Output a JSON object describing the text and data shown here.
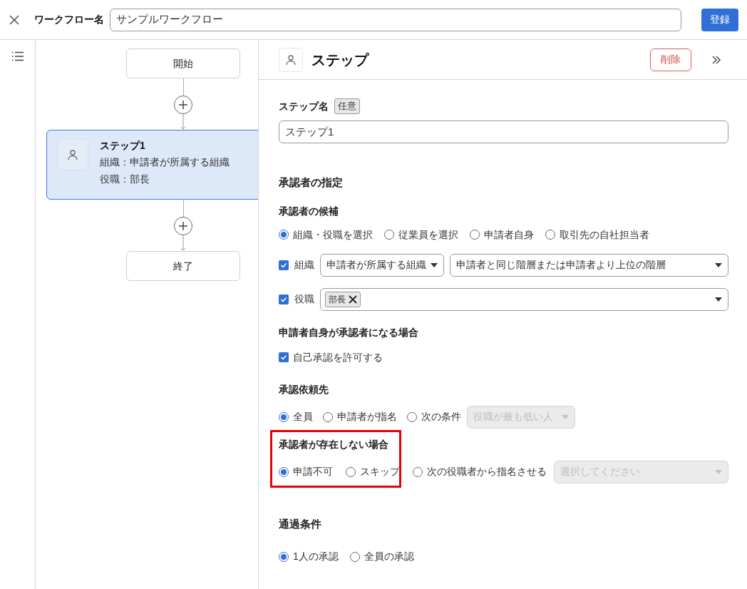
{
  "header": {
    "label": "ワークフロー名",
    "value": "サンプルワークフロー",
    "submit": "登録"
  },
  "flow": {
    "nodes": [
      {
        "kind": "terminal",
        "title": "開始",
        "selected": false
      },
      {
        "kind": "step",
        "title": "ステップ1",
        "lines": [
          "組織：申請者が所属する組織",
          "役職：部長"
        ],
        "selected": true
      },
      {
        "kind": "terminal",
        "title": "終了",
        "selected": false
      }
    ]
  },
  "panel": {
    "title": "ステップ",
    "delete": "削除",
    "step_name": {
      "label": "ステップ名",
      "badge": "任意",
      "value": "ステップ1"
    },
    "approver_heading": "承認者の指定",
    "candidates": {
      "label": "承認者の候補",
      "options": [
        {
          "label": "組織・役職を選択",
          "selected": true
        },
        {
          "label": "従業員を選択",
          "selected": false
        },
        {
          "label": "申請者自身",
          "selected": false
        },
        {
          "label": "取引先の自社担当者",
          "selected": false
        }
      ]
    },
    "org": {
      "label": "組織",
      "checked": true,
      "selects": [
        "申請者が所属する組織",
        "申請者と同じ階層または申請者より上位の階層"
      ]
    },
    "role": {
      "label": "役職",
      "checked": true,
      "tags": [
        "部長"
      ]
    },
    "self": {
      "label": "申請者自身が承認者になる場合",
      "checkbox": {
        "label": "自己承認を許可する",
        "checked": true
      }
    },
    "request": {
      "label": "承認依頼先",
      "options": [
        {
          "label": "全員",
          "selected": true
        },
        {
          "label": "申請者が指名",
          "selected": false
        },
        {
          "label": "次の条件",
          "selected": false
        }
      ],
      "select": {
        "value": "役職が最も低い人",
        "disabled": true
      }
    },
    "missing": {
      "label": "承認者が存在しない場合",
      "highlighted": true,
      "options": [
        {
          "label": "申請不可",
          "selected": true
        },
        {
          "label": "スキップ",
          "selected": false
        },
        {
          "label": "次の役職者から指名させる",
          "selected": false
        }
      ],
      "select": {
        "placeholder": "選択してください",
        "disabled": true
      }
    },
    "pass_heading": "通過条件",
    "pass": {
      "options": [
        {
          "label": "1人の承認",
          "selected": true
        },
        {
          "label": "全員の承認",
          "selected": false
        }
      ]
    }
  }
}
